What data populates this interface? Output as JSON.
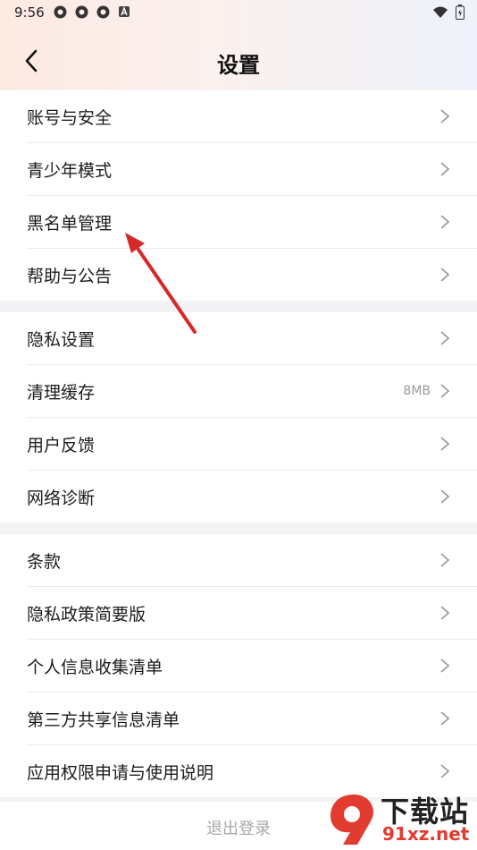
{
  "status_bar": {
    "time": "9:56"
  },
  "header": {
    "title": "设置"
  },
  "groups": [
    {
      "items": [
        {
          "label": "账号与安全"
        },
        {
          "label": "青少年模式"
        },
        {
          "label": "黑名单管理"
        },
        {
          "label": "帮助与公告"
        }
      ]
    },
    {
      "items": [
        {
          "label": "隐私设置"
        },
        {
          "label": "清理缓存",
          "value": "8MB"
        },
        {
          "label": "用户反馈"
        },
        {
          "label": "网络诊断"
        }
      ]
    },
    {
      "items": [
        {
          "label": "条款"
        },
        {
          "label": "隐私政策简要版"
        },
        {
          "label": "个人信息收集清单"
        },
        {
          "label": "第三方共享信息清单"
        },
        {
          "label": "应用权限申请与使用说明"
        }
      ]
    }
  ],
  "logout_label": "退出登录",
  "annotation": {
    "color": "#d62828"
  },
  "watermark": {
    "brand": "下载站",
    "site": "91xz.net"
  }
}
